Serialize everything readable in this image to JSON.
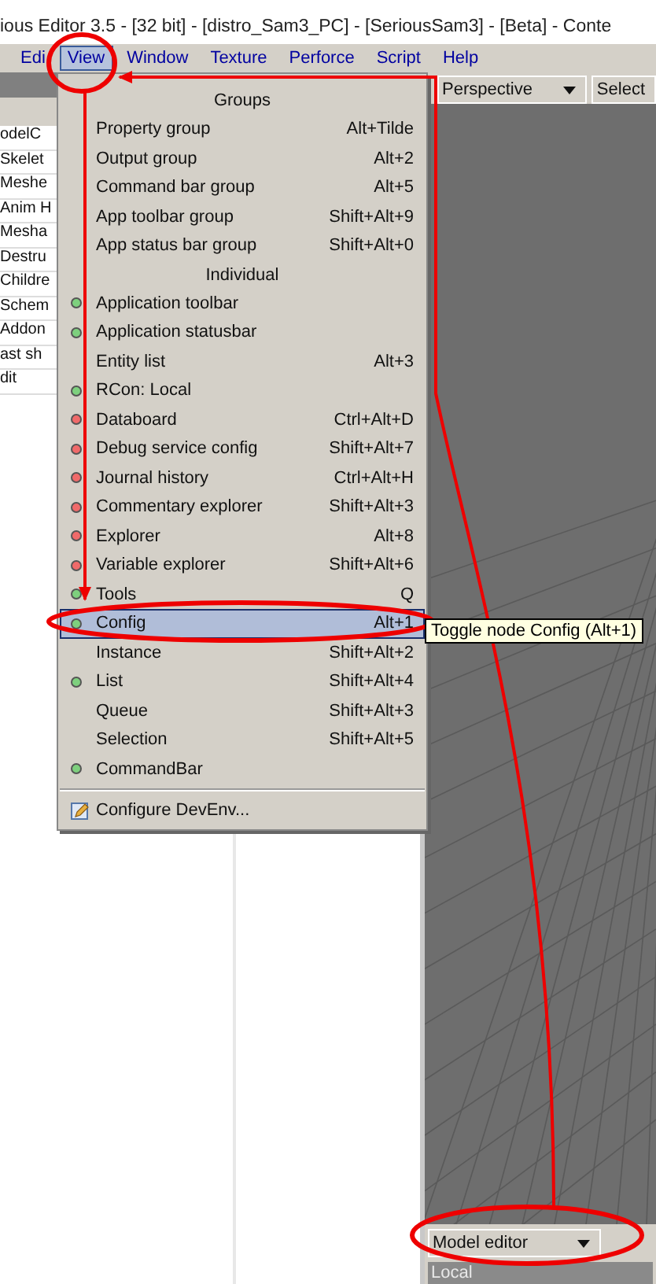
{
  "window": {
    "title": "ious Editor 3.5 - [32 bit] - [distro_Sam3_PC] - [SeriousSam3] - [Beta] - Conte"
  },
  "menu_bar": [
    {
      "label": "Edi",
      "selected": false
    },
    {
      "label": "View",
      "selected": true
    },
    {
      "label": "Window",
      "selected": false
    },
    {
      "label": "Texture",
      "selected": false
    },
    {
      "label": "Perforce",
      "selected": false
    },
    {
      "label": "Script",
      "selected": false
    },
    {
      "label": "Help",
      "selected": false
    }
  ],
  "left_list": [
    "odelC",
    "Skelet",
    "Meshe",
    "Anim H",
    "Mesha",
    "Destru",
    "Childre",
    "Schem",
    "Addon",
    "ast sh",
    "dit"
  ],
  "view_menu": [
    {
      "kind": "header",
      "label": "Groups"
    },
    {
      "kind": "item",
      "label": "Property group",
      "shortcut": "Alt+Tilde",
      "selected": false
    },
    {
      "kind": "item",
      "label": "Output group",
      "shortcut": "Alt+2",
      "selected": false
    },
    {
      "kind": "item",
      "label": "Command bar group",
      "shortcut": "Alt+5",
      "selected": false
    },
    {
      "kind": "item",
      "label": "App toolbar group",
      "shortcut": "Shift+Alt+9",
      "selected": false
    },
    {
      "kind": "item",
      "label": "App status bar group",
      "shortcut": "Shift+Alt+0",
      "selected": false
    },
    {
      "kind": "header",
      "label": "Individual"
    },
    {
      "kind": "item",
      "label": "Application toolbar",
      "color": "#7ed07e",
      "selected": false
    },
    {
      "kind": "item",
      "label": "Application statusbar",
      "color": "#7ed07e",
      "selected": false
    },
    {
      "kind": "item",
      "label": "Entity list",
      "shortcut": "Alt+3",
      "selected": false
    },
    {
      "kind": "item",
      "label": "RCon: Local",
      "color": "#7ed07e",
      "selected": false
    },
    {
      "kind": "item",
      "label": "Databoard",
      "shortcut": "Ctrl+Alt+D",
      "color": "#f06a6a",
      "selected": false
    },
    {
      "kind": "item",
      "label": "Debug service config",
      "shortcut": "Shift+Alt+7",
      "color": "#f06a6a",
      "selected": false
    },
    {
      "kind": "item",
      "label": "Journal history",
      "shortcut": "Ctrl+Alt+H",
      "color": "#f06a6a",
      "selected": false
    },
    {
      "kind": "item",
      "label": "Commentary explorer",
      "shortcut": "Shift+Alt+3",
      "color": "#f06a6a",
      "selected": false
    },
    {
      "kind": "item",
      "label": "Explorer",
      "shortcut": "Alt+8",
      "color": "#f06a6a",
      "selected": false
    },
    {
      "kind": "item",
      "label": "Variable explorer",
      "shortcut": "Shift+Alt+6",
      "color": "#f06a6a",
      "selected": false
    },
    {
      "kind": "item",
      "label": "Tools",
      "shortcut": "Q",
      "color": "#7ed07e",
      "selected": false
    },
    {
      "kind": "item",
      "label": "Config",
      "shortcut": "Alt+1",
      "color": "#7ed07e",
      "selected": true
    },
    {
      "kind": "item",
      "label": "Instance",
      "shortcut": "Shift+Alt+2",
      "selected": false
    },
    {
      "kind": "item",
      "label": "List",
      "shortcut": "Shift+Alt+4",
      "color": "#7ed07e",
      "selected": false
    },
    {
      "kind": "item",
      "label": "Queue",
      "shortcut": "Shift+Alt+3",
      "selected": false
    },
    {
      "kind": "item",
      "label": "Selection",
      "shortcut": "Shift+Alt+5",
      "selected": false
    },
    {
      "kind": "item",
      "label": "CommandBar",
      "color": "#7ed07e",
      "selected": false
    },
    {
      "kind": "separator"
    },
    {
      "kind": "action",
      "label": "Configure DevEnv...",
      "selected": false
    }
  ],
  "tooltip": "Toggle node Config (Alt+1)",
  "viewport": {
    "camera": "Perspective",
    "select": "Select",
    "mode": "Model editor",
    "status": "Local"
  }
}
